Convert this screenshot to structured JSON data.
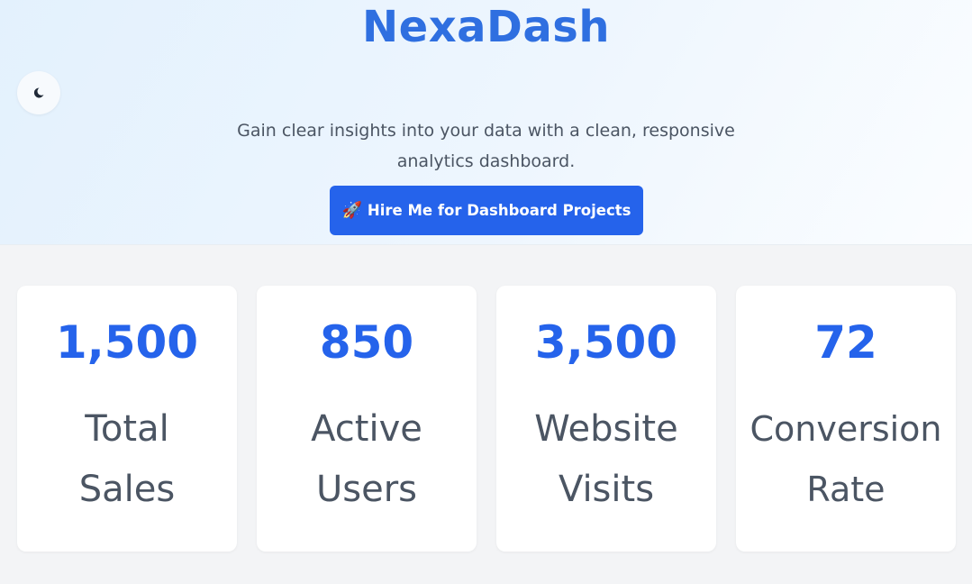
{
  "brand": {
    "title": "NexaDash"
  },
  "theme_toggle": {
    "icon": "moon-icon"
  },
  "hero": {
    "tagline_line1": "Gain clear insights into your data with a clean, responsive",
    "tagline_line2": "analytics dashboard.",
    "cta_icon": "🚀",
    "cta_label": "Hire Me for Dashboard Projects"
  },
  "stats": [
    {
      "value": "1,500",
      "label_line1": "Total",
      "label_line2": "Sales"
    },
    {
      "value": "850",
      "label_line1": "Active",
      "label_line2": "Users"
    },
    {
      "value": "3,500",
      "label_line1": "Website",
      "label_line2": "Visits"
    },
    {
      "value": "72",
      "label_line1": "Conversion",
      "label_line2": "Rate"
    }
  ],
  "colors": {
    "accent": "#2563eb",
    "brand_title": "#2f6fe0",
    "text_muted": "#4b5563",
    "page_bg": "#f3f4f6"
  }
}
